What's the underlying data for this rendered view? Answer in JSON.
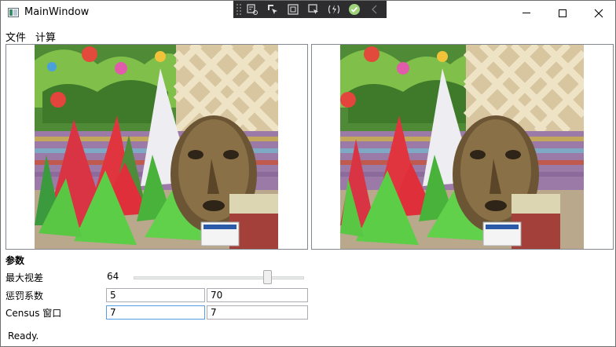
{
  "window": {
    "title": "MainWindow"
  },
  "menu": {
    "items": [
      "文件",
      "计算"
    ]
  },
  "params": {
    "section_title": "参数",
    "max_disparity": {
      "label": "最大视差",
      "value": "64",
      "slider_fraction": 0.8
    },
    "penalty": {
      "label": "惩罚系数",
      "p1": "5",
      "p2": "70"
    },
    "census": {
      "label": "Census 窗口",
      "w": "7",
      "h": "7"
    }
  },
  "status": "Ready."
}
